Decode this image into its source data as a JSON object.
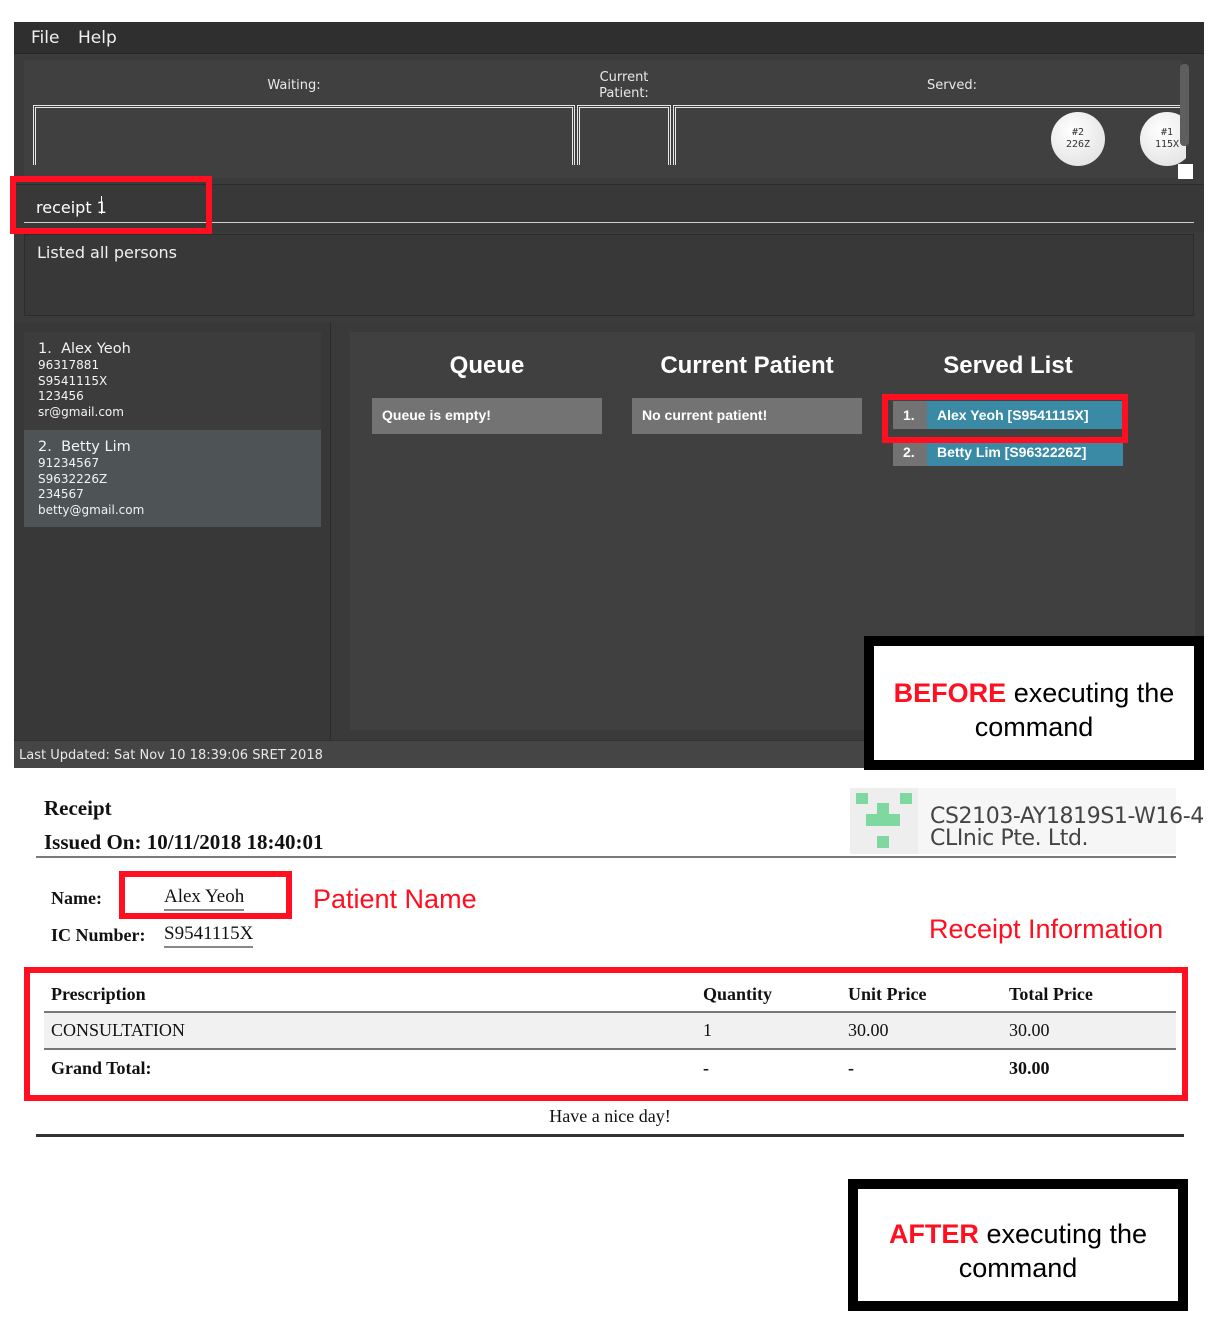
{
  "app": {
    "menu": [
      "File",
      "Help"
    ],
    "queue_strip": {
      "waiting_label": "Waiting:",
      "current_label_line1": "Current",
      "current_label_line2": "Patient:",
      "served_label": "Served:",
      "served_tokens": [
        {
          "number": "#2",
          "code": "226Z"
        },
        {
          "number": "#1",
          "code": "115X"
        }
      ]
    },
    "command_box": {
      "value": "receipt 1",
      "placeholder": ""
    },
    "result_display": "Listed all persons",
    "persons": [
      {
        "index": "1.",
        "name": "Alex Yeoh",
        "phone": "96317881",
        "nric": "S9541115X",
        "address": "123456",
        "email": "sr@gmail.com"
      },
      {
        "index": "2.",
        "name": "Betty Lim",
        "phone": "91234567",
        "nric": "S9632226Z",
        "address": "234567",
        "email": "betty@gmail.com"
      }
    ],
    "queue_panel": {
      "queue_title": "Queue",
      "queue_empty": "Queue is empty!",
      "current_title": "Current Patient",
      "current_empty": "No current patient!",
      "served_title": "Served List",
      "served_list": [
        {
          "index": "1.",
          "label": "Alex Yeoh [S9541115X]"
        },
        {
          "index": "2.",
          "label": "Betty Lim [S9632226Z]"
        }
      ]
    },
    "status_bar": "Last Updated: Sat Nov 10 18:39:06 SRET 2018"
  },
  "annotations": {
    "before_strong": "BEFORE",
    "before_rest": " executing the",
    "before_line2": "command",
    "after_strong": "AFTER",
    "after_rest": " executing the",
    "after_line2": "command",
    "patient_name_label": "Patient Name",
    "receipt_info_label": "Receipt Information",
    "highlight_color": "#ff0f1f"
  },
  "receipt": {
    "title": "Receipt",
    "issued_on": "Issued On: 10/11/2018 18:40:01",
    "clinic_line1": "CS2103-AY1819S1-W16-4",
    "clinic_line2": "CLInic Pte. Ltd.",
    "name_label": "Name:",
    "name_value": "Alex Yeoh",
    "ic_label": "IC Number:",
    "ic_value": "S9541115X",
    "table": {
      "headers": [
        "Prescription",
        "Quantity",
        "Unit Price",
        "Total Price"
      ],
      "rows": [
        [
          "CONSULTATION",
          "1",
          "30.00",
          "30.00"
        ]
      ],
      "total_row": [
        "Grand Total:",
        "-",
        "-",
        "30.00"
      ]
    },
    "footer": "Have a nice day!"
  },
  "colors": {
    "served_accent": "#3a8aa5",
    "logo_green": "#7fd8a0"
  }
}
